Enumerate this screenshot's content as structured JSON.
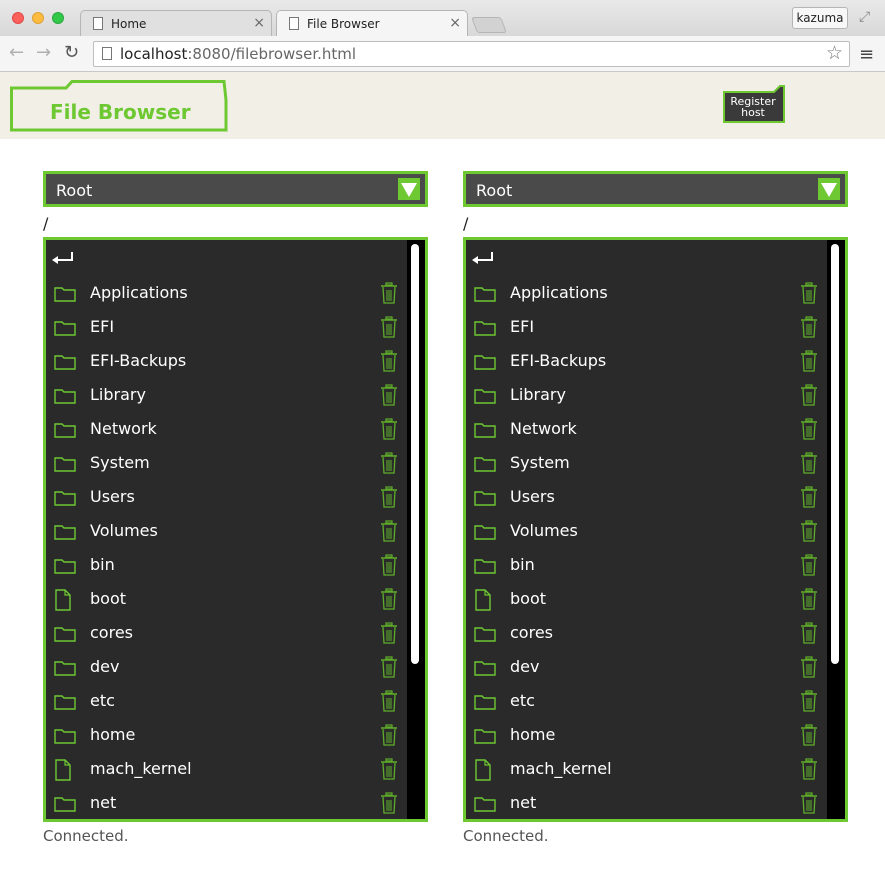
{
  "browser": {
    "tabs": [
      {
        "title": "Home",
        "close": "×"
      },
      {
        "title": "File Browser",
        "close": "×"
      }
    ],
    "profile": "kazuma",
    "url_host": "localhost",
    "url_path": ":8080/filebrowser.html"
  },
  "header": {
    "title": "File Browser",
    "register_line1": "Register",
    "register_line2": "host"
  },
  "colors": {
    "accent": "#6dc832",
    "list_bg": "#2a2a2a",
    "select_bg": "#4a4a4a",
    "header_bg": "#f2efe6"
  },
  "panels": [
    {
      "select_value": "Root",
      "path": "/",
      "status": "Connected.",
      "entries": [
        {
          "name": "Applications",
          "icon": "folder-icon"
        },
        {
          "name": "EFI",
          "icon": "folder-icon"
        },
        {
          "name": "EFI-Backups",
          "icon": "folder-icon"
        },
        {
          "name": "Library",
          "icon": "folder-icon"
        },
        {
          "name": "Network",
          "icon": "folder-icon"
        },
        {
          "name": "System",
          "icon": "folder-icon"
        },
        {
          "name": "Users",
          "icon": "folder-icon"
        },
        {
          "name": "Volumes",
          "icon": "folder-icon"
        },
        {
          "name": "bin",
          "icon": "folder-icon"
        },
        {
          "name": "boot",
          "icon": "file-icon"
        },
        {
          "name": "cores",
          "icon": "folder-icon"
        },
        {
          "name": "dev",
          "icon": "folder-icon"
        },
        {
          "name": "etc",
          "icon": "folder-icon"
        },
        {
          "name": "home",
          "icon": "folder-icon"
        },
        {
          "name": "mach_kernel",
          "icon": "file-icon"
        },
        {
          "name": "net",
          "icon": "folder-icon"
        }
      ]
    },
    {
      "select_value": "Root",
      "path": "/",
      "status": "Connected.",
      "entries": [
        {
          "name": "Applications",
          "icon": "folder-icon"
        },
        {
          "name": "EFI",
          "icon": "folder-icon"
        },
        {
          "name": "EFI-Backups",
          "icon": "folder-icon"
        },
        {
          "name": "Library",
          "icon": "folder-icon"
        },
        {
          "name": "Network",
          "icon": "folder-icon"
        },
        {
          "name": "System",
          "icon": "folder-icon"
        },
        {
          "name": "Users",
          "icon": "folder-icon"
        },
        {
          "name": "Volumes",
          "icon": "folder-icon"
        },
        {
          "name": "bin",
          "icon": "folder-icon"
        },
        {
          "name": "boot",
          "icon": "file-icon"
        },
        {
          "name": "cores",
          "icon": "folder-icon"
        },
        {
          "name": "dev",
          "icon": "folder-icon"
        },
        {
          "name": "etc",
          "icon": "folder-icon"
        },
        {
          "name": "home",
          "icon": "folder-icon"
        },
        {
          "name": "mach_kernel",
          "icon": "file-icon"
        },
        {
          "name": "net",
          "icon": "folder-icon"
        }
      ]
    }
  ]
}
